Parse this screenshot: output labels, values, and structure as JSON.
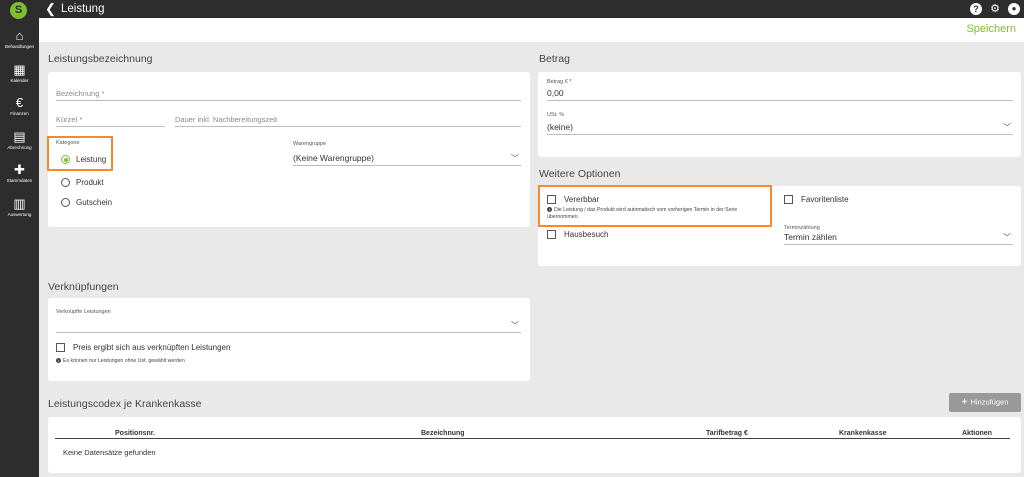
{
  "sidebar": {
    "logo": "S",
    "items": [
      {
        "icon": "home-icon",
        "glyph": "⌂",
        "label": "Behandlungen"
      },
      {
        "icon": "calendar-icon",
        "glyph": "▦",
        "label": "Kalender"
      },
      {
        "icon": "euro-icon",
        "glyph": "€",
        "label": "Finanzen"
      },
      {
        "icon": "document-icon",
        "glyph": "▤",
        "label": "Abrechnung"
      },
      {
        "icon": "puzzle-icon",
        "glyph": "✚",
        "label": "Stammdaten"
      },
      {
        "icon": "bar-chart-icon",
        "glyph": "▥",
        "label": "Auswertung"
      }
    ]
  },
  "header": {
    "title": "Leistung",
    "back_glyph": "❮",
    "help_glyph": "?",
    "gear_glyph": "⚙",
    "user_glyph": "●"
  },
  "actions": {
    "save_label": "Speichern"
  },
  "leistungsbezeichnung": {
    "title": "Leistungsbezeichnung",
    "bezeichnung_placeholder": "Bezeichnung *",
    "kuerzel_placeholder": "Kürzel *",
    "dauer_placeholder": "Dauer inkl. Nachbereitungszeit",
    "kategorie_label": "Kategorie",
    "kategorie_options": [
      "Leistung",
      "Produkt",
      "Gutschein"
    ],
    "kategorie_selected": "Leistung",
    "warengruppe_label": "Warengruppe",
    "warengruppe_value": "(Keine Warengruppe)"
  },
  "betrag": {
    "title": "Betrag",
    "betrag_label": "Betrag € *",
    "betrag_value": "0,00",
    "ust_label": "USt. %",
    "ust_value": "(keine)"
  },
  "weitere_optionen": {
    "title": "Weitere Optionen",
    "vererbbar_label": "Vererbbar",
    "vererbbar_note": "Die Leistung / das Produkt wird automatisch vom vorherigen Termin in der Serie übernommen.",
    "favoritenliste_label": "Favoritenliste",
    "hausbesuch_label": "Hausbesuch",
    "terminzaehlung_label": "Terminzählung",
    "terminzaehlung_value": "Termin zählen"
  },
  "verknuepfungen": {
    "title": "Verknüpfungen",
    "verknuepfte_label": "Verknüpfte Leistungen",
    "preis_label": "Preis ergibt sich aus verknüpften Leistungen",
    "note": "Es können nur Leistungen ohne Ust. gewählt werden"
  },
  "leistungscodex": {
    "title": "Leistungscodex je Krankenkasse",
    "add_label": "Hinzufügen",
    "columns": [
      "Positionsnr.",
      "Bezeichnung",
      "Tarifbetrag €",
      "Krankenkasse",
      "Aktionen"
    ],
    "empty_text": "Keine Datensätze gefunden"
  },
  "colors": {
    "accent": "#7dbf2e",
    "highlight": "#f28a2e",
    "dark": "#2d2d2d"
  }
}
